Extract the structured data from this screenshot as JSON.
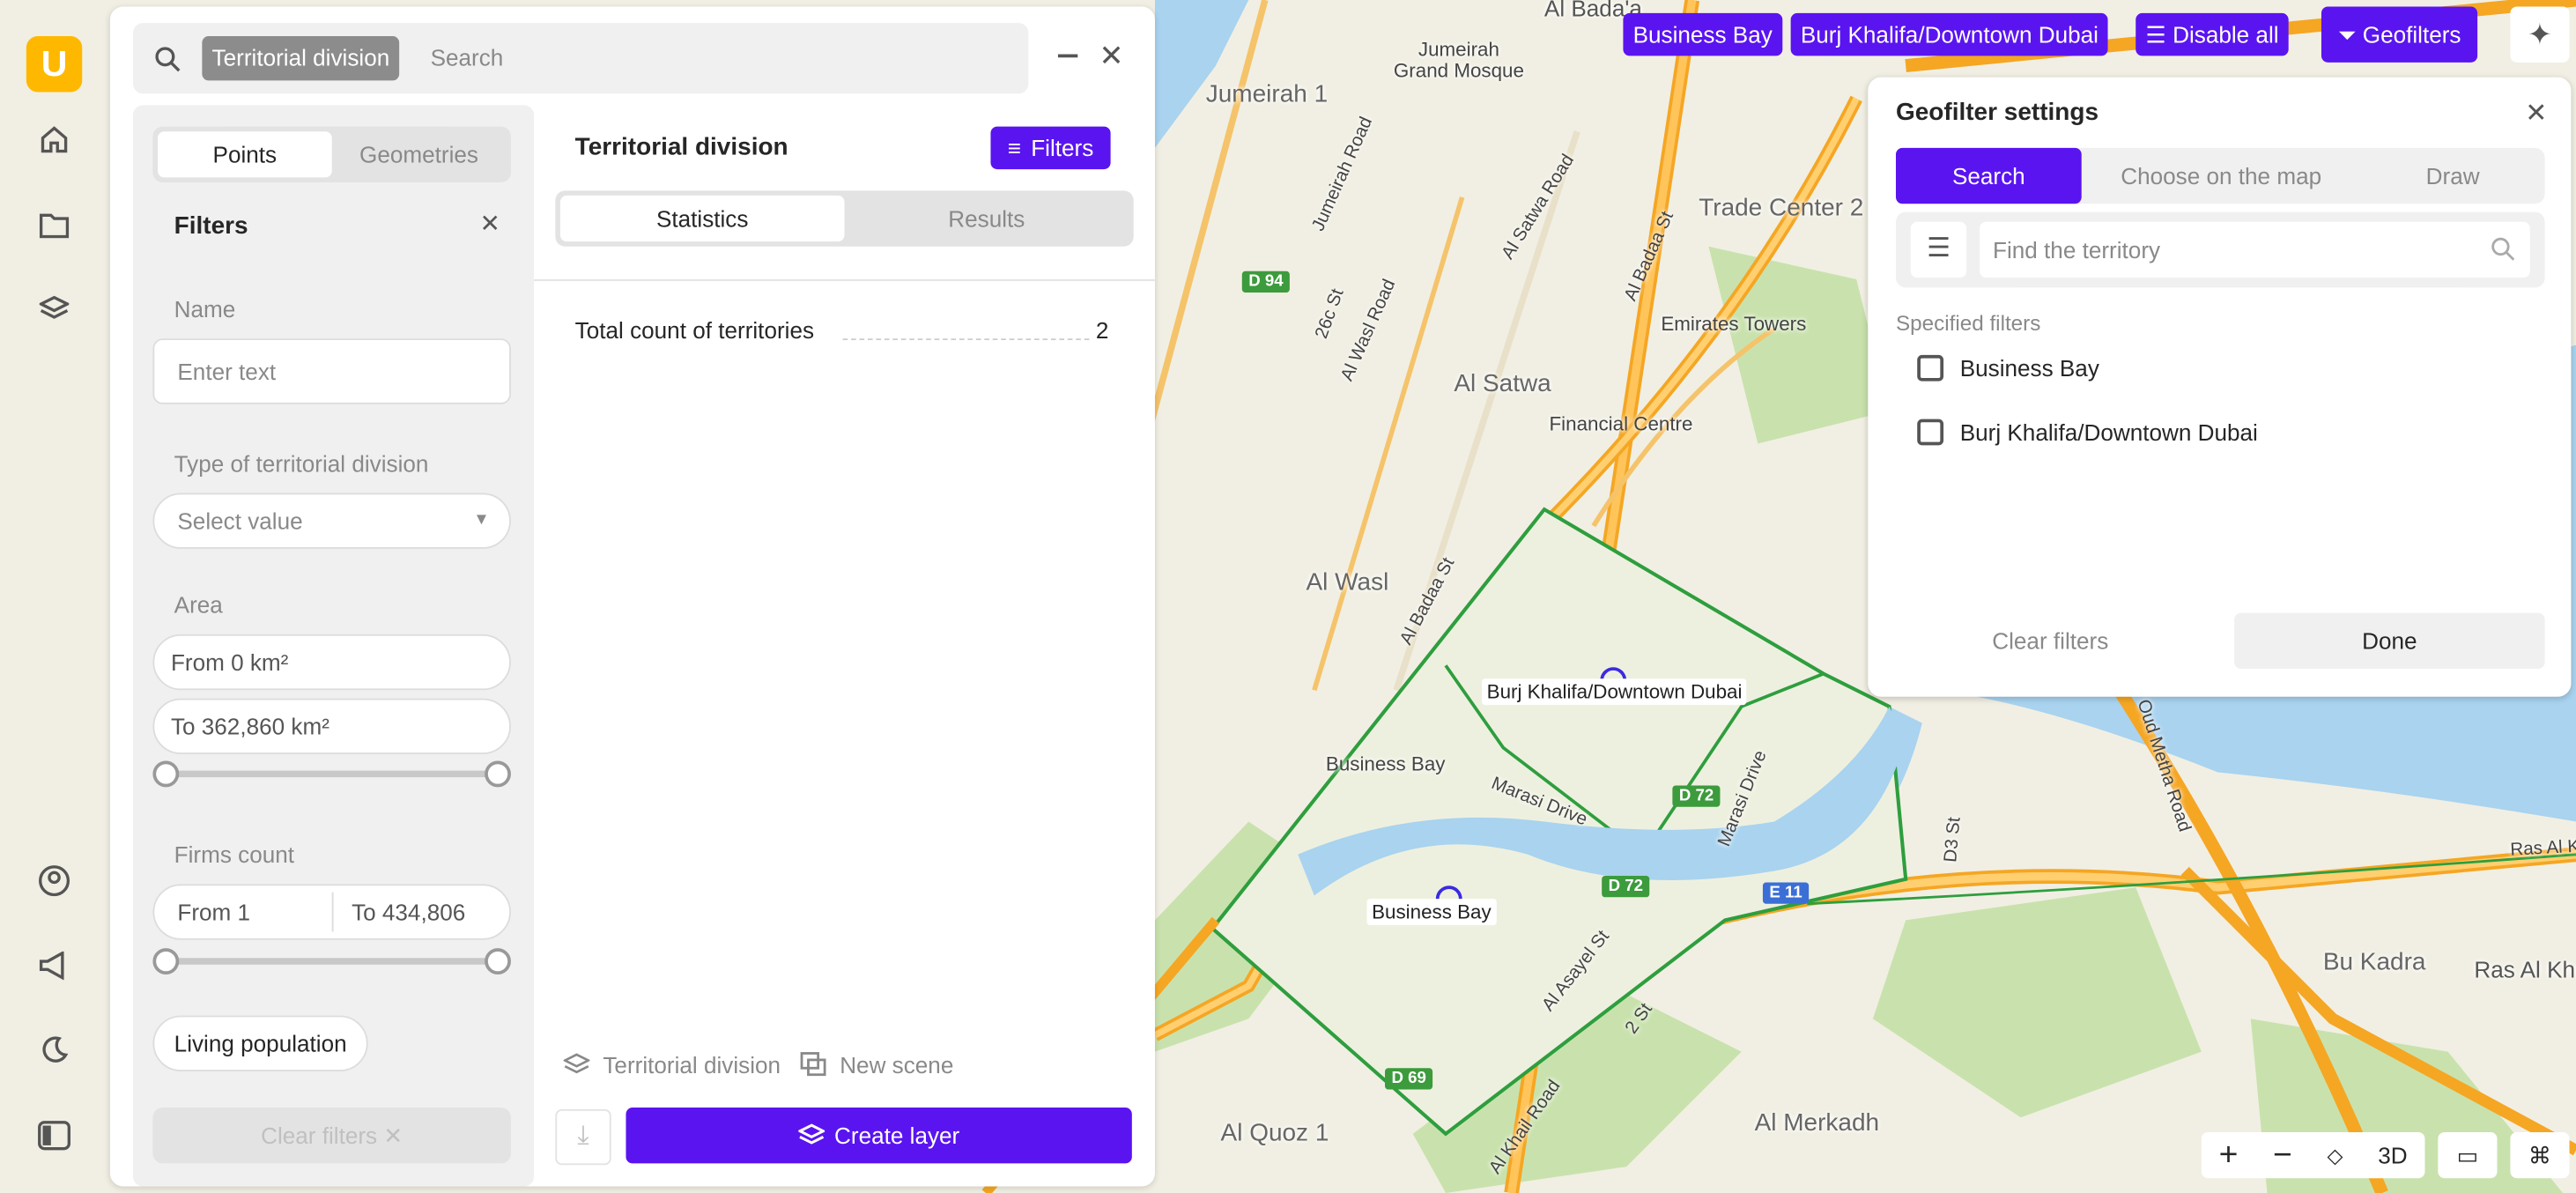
{
  "search": {
    "chip": "Territorial division",
    "placeholder": "Search"
  },
  "left": {
    "seg": [
      "Points",
      "Geometries"
    ],
    "filters_title": "Filters",
    "name_label": "Name",
    "name_placeholder": "Enter text",
    "type_label": "Type of territorial division",
    "type_value": "Select value",
    "area_label": "Area",
    "area_from": "From 0 km²",
    "area_to": "To 362,860 km²",
    "firms_label": "Firms count",
    "firms_from": "From 1",
    "firms_to": "To 434,806",
    "living": "Living population",
    "clear": "Clear filters"
  },
  "right": {
    "title": "Territorial division",
    "filters_btn": "Filters",
    "tabs": [
      "Statistics",
      "Results"
    ],
    "stat_label": "Total count of territories",
    "stat_value": "2",
    "foot_layer": "Territorial division",
    "foot_scene": "New scene",
    "create": "Create layer"
  },
  "top": {
    "tags": [
      "Business Bay",
      "Burj Khalifa/Downtown Dubai"
    ],
    "disable": "Disable all",
    "geofilters": "Geofilters"
  },
  "geo": {
    "title": "Geofilter settings",
    "tabs": [
      "Search",
      "Choose on the map",
      "Draw"
    ],
    "find_placeholder": "Find the territory",
    "specified": "Specified filters",
    "items": [
      "Business Bay",
      "Burj Khalifa/Downtown Dubai"
    ],
    "clear": "Clear filters",
    "done": "Done"
  },
  "map": {
    "labels": [
      "Al Bada'a",
      "Jumeirah Grand Mosque",
      "Jumeirah 1",
      "Trade Center 2",
      "Emirates Towers",
      "Al Satwa",
      "Financial Centre",
      "Al Wasl",
      "Business Bay",
      "Business Bay",
      "Burj Khalifa/Downtown Dubai",
      "Bu Kadra",
      "Ras Al Khor",
      "Al Merkadh",
      "Al Quoz 1",
      "Marasi Drive",
      "Marasi Drive",
      "Al Badaa St",
      "Al Badaa St",
      "Al Satwa Road",
      "Jumeirah Road",
      "Al Wasl Road",
      "26c St",
      "Al Asayel St",
      "2 St",
      "Oud Metha Road",
      "Ras Al Khor",
      "D3 St",
      "Al Khail Road"
    ],
    "shields": [
      "D 94",
      "D 72",
      "D 72",
      "E 11",
      "D 69"
    ],
    "controls": {
      "three_d": "3D"
    }
  },
  "colors": {
    "accent": "#5a14f0",
    "brand": "#ffb800",
    "boundary": "#2e9e3e"
  }
}
